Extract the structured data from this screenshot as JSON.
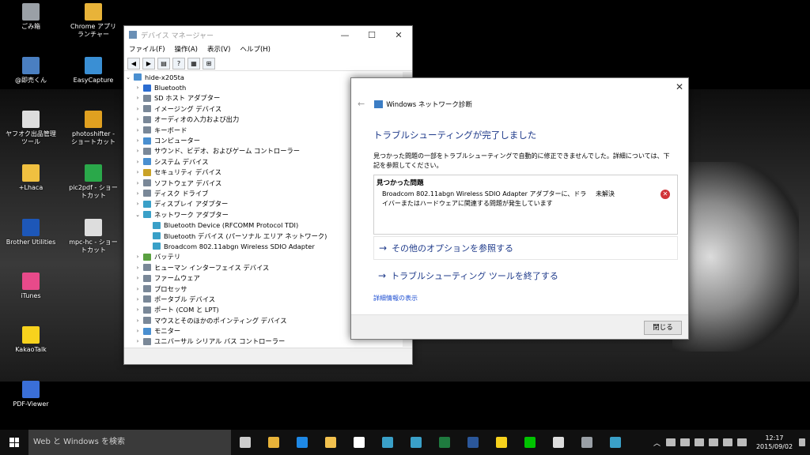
{
  "desktop_icons": [
    {
      "label": "ごみ箱",
      "color": "#9aa0a6"
    },
    {
      "label": "Chrome アプリ ランチャー",
      "color": "#e8b339"
    },
    {
      "label": "@即売くん",
      "color": "#4a7fc1"
    },
    {
      "label": "EasyCapture",
      "color": "#3a8fd4"
    },
    {
      "label": "ヤフオク出品管理ツール",
      "color": "#dddddd"
    },
    {
      "label": "photoshifter - ショートカット",
      "color": "#e0a020"
    },
    {
      "label": "+Lhaca",
      "color": "#f0c040"
    },
    {
      "label": "pic2pdf - ショートカット",
      "color": "#2aa84a"
    },
    {
      "label": "Brother Utilities",
      "color": "#1d57b8"
    },
    {
      "label": "mpc-hc - ショートカット",
      "color": "#dddddd"
    },
    {
      "label": "iTunes",
      "color": "#e84a8a"
    },
    {
      "label": "KakaoTalk",
      "color": "#f7d21d"
    },
    {
      "label": "PDF-Viewer",
      "color": "#3a6fd8"
    }
  ],
  "device_manager": {
    "title": "デバイス マネージャー",
    "menu": [
      "ファイル(F)",
      "操作(A)",
      "表示(V)",
      "ヘルプ(H)"
    ],
    "root": "hide-x205ta",
    "items": [
      {
        "label": "Bluetooth",
        "expanded": false,
        "color": "#2b6cd1"
      },
      {
        "label": "SD ホスト アダプター",
        "expanded": false,
        "color": "#7a8898"
      },
      {
        "label": "イメージング デバイス",
        "expanded": false,
        "color": "#7a8898"
      },
      {
        "label": "オーディオの入力および出力",
        "expanded": false,
        "color": "#7a8898"
      },
      {
        "label": "キーボード",
        "expanded": false,
        "color": "#7a8898"
      },
      {
        "label": "コンピューター",
        "expanded": false,
        "color": "#4a8fd0"
      },
      {
        "label": "サウンド、ビデオ、およびゲーム コントローラー",
        "expanded": false,
        "color": "#7a8898"
      },
      {
        "label": "システム デバイス",
        "expanded": false,
        "color": "#4a8fd0"
      },
      {
        "label": "セキュリティ デバイス",
        "expanded": false,
        "color": "#c9a227"
      },
      {
        "label": "ソフトウェア デバイス",
        "expanded": false,
        "color": "#7a8898"
      },
      {
        "label": "ディスク ドライブ",
        "expanded": false,
        "color": "#7a8898"
      },
      {
        "label": "ディスプレイ アダプター",
        "expanded": false,
        "color": "#3aa0c8"
      },
      {
        "label": "ネットワーク アダプター",
        "expanded": true,
        "color": "#3aa0c8"
      },
      {
        "label": "Bluetooth Device (RFCOMM Protocol TDI)",
        "child": true,
        "color": "#3aa0c8"
      },
      {
        "label": "Bluetooth デバイス (パーソナル エリア ネットワーク)",
        "child": true,
        "color": "#3aa0c8"
      },
      {
        "label": "Broadcom 802.11abgn Wireless SDIO Adapter",
        "child": true,
        "color": "#3aa0c8"
      },
      {
        "label": "バッテリ",
        "expanded": false,
        "color": "#5aa040"
      },
      {
        "label": "ヒューマン インターフェイス デバイス",
        "expanded": false,
        "color": "#7a8898"
      },
      {
        "label": "ファームウェア",
        "expanded": false,
        "color": "#7a8898"
      },
      {
        "label": "プロセッサ",
        "expanded": false,
        "color": "#7a8898"
      },
      {
        "label": "ポータブル デバイス",
        "expanded": false,
        "color": "#7a8898"
      },
      {
        "label": "ポート (COM と LPT)",
        "expanded": false,
        "color": "#7a8898"
      },
      {
        "label": "マウスとそのほかのポインティング デバイス",
        "expanded": false,
        "color": "#7a8898"
      },
      {
        "label": "モニター",
        "expanded": false,
        "color": "#4a8fd0"
      },
      {
        "label": "ユニバーサル シリアル バス コントローラー",
        "expanded": false,
        "color": "#7a8898"
      }
    ]
  },
  "net_diag": {
    "title": "Windows ネットワーク診断",
    "heading": "トラブルシューティングが完了しました",
    "description": "見つかった問題の一部をトラブルシューティングで自動的に修正できませんでした。詳細については、下記を参照してください。",
    "problems_header": "見つかった問題",
    "problem_text": "Broadcom 802.11abgn Wireless SDIO Adapter アダプターに、ドライバーまたはハードウェアに関連する問題が発生しています",
    "problem_status": "未解決",
    "option1": "その他のオプションを参照する",
    "option2": "トラブルシューティング ツールを終了する",
    "details_link": "詳細情報の表示",
    "close_button": "閉じる"
  },
  "taskbar": {
    "search_placeholder": "Web と Windows を検索",
    "apps": [
      {
        "name": "task-view-icon",
        "color": "#cccccc"
      },
      {
        "name": "store-apps-icon",
        "color": "#e8b339"
      },
      {
        "name": "edge-icon",
        "color": "#1e88e5"
      },
      {
        "name": "file-explorer-icon",
        "color": "#f2c14e"
      },
      {
        "name": "store-icon",
        "color": "#ffffff"
      },
      {
        "name": "network-diag-icon",
        "color": "#3aa0c8"
      },
      {
        "name": "device-icon",
        "color": "#3aa0c8"
      },
      {
        "name": "excel-icon",
        "color": "#1f7a3f"
      },
      {
        "name": "word-icon",
        "color": "#2b579a"
      },
      {
        "name": "kakaotalk-icon",
        "color": "#f7d21d"
      },
      {
        "name": "line-icon",
        "color": "#00c300"
      },
      {
        "name": "calculator-icon",
        "color": "#dddddd"
      },
      {
        "name": "device-manager-icon",
        "color": "#9aa0a6"
      },
      {
        "name": "diagnostics-icon",
        "color": "#3aa0c8"
      }
    ],
    "time": "12:17",
    "date": "2015/09/02"
  }
}
